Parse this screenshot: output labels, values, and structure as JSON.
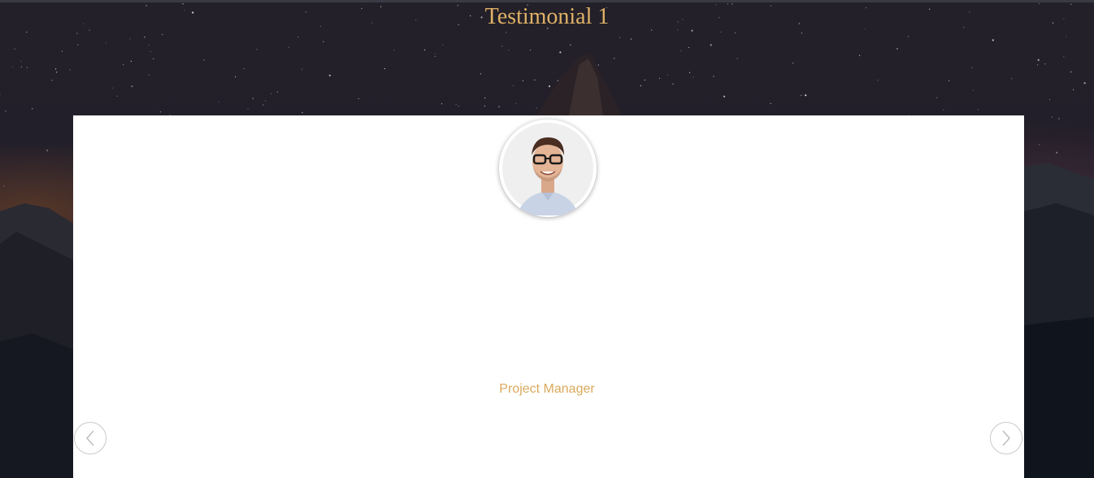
{
  "testimonial": {
    "title": "Testimonial 1",
    "role": "Project Manager"
  },
  "navigation": {
    "prev_icon": "chevron-left-icon",
    "next_icon": "chevron-right-icon"
  },
  "colors": {
    "accent": "#e0b266",
    "role_text": "#d9a95b",
    "card_background": "#ffffff"
  }
}
